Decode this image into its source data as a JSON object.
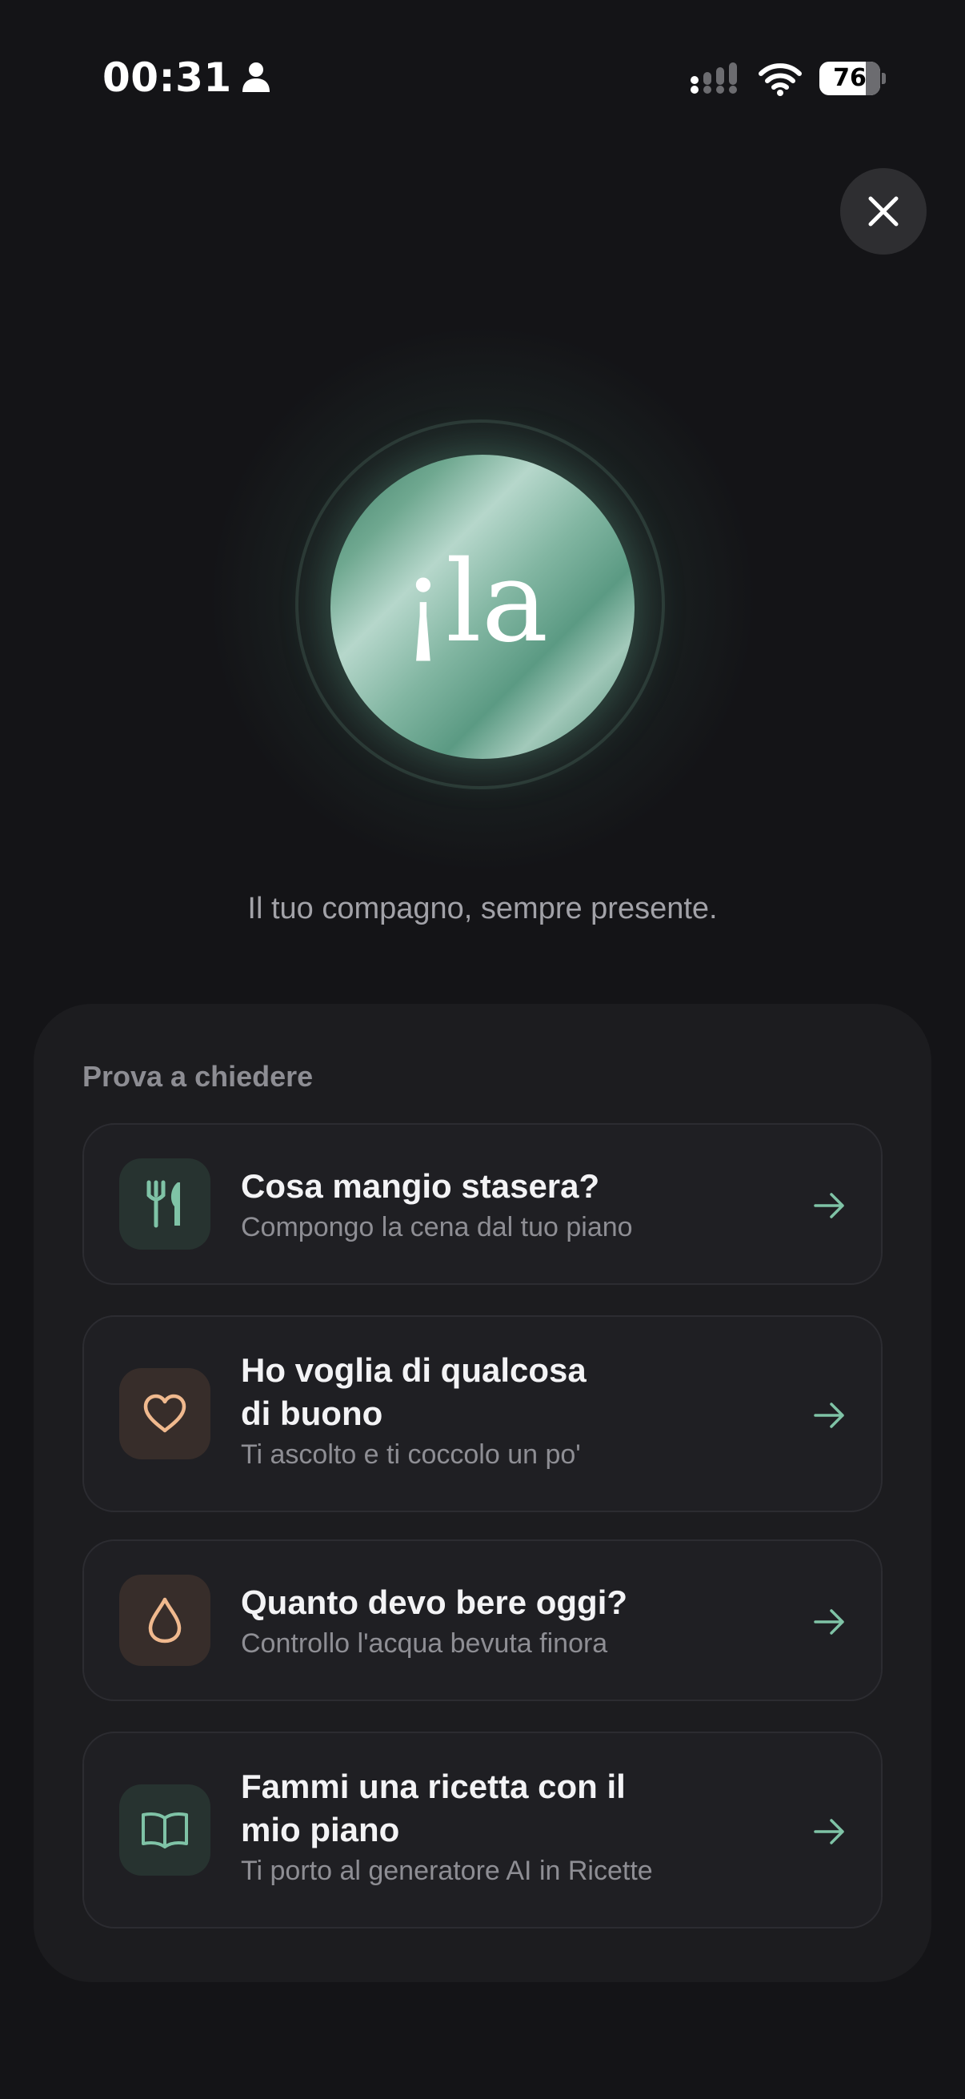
{
  "status_bar": {
    "time": "00:31",
    "battery_level": "76",
    "icons": [
      "person-icon",
      "signal-icon",
      "wifi-icon",
      "battery-icon"
    ]
  },
  "close_button": {
    "icon": "close-icon"
  },
  "logo": {
    "text": "¡la"
  },
  "tagline": "Il tuo compagno, sempre presente.",
  "suggestions": {
    "title": "Prova a chiedere",
    "items": [
      {
        "icon": "fork-knife-icon",
        "title": "Cosa mangio stasera?",
        "subtitle": "Compongo la cena dal tuo piano"
      },
      {
        "icon": "heart-icon",
        "title": "Ho voglia di qualcosa\ndi buono",
        "subtitle": "Ti ascolto e ti coccolo un po'"
      },
      {
        "icon": "water-drop-icon",
        "title": "Quanto devo bere oggi?",
        "subtitle": "Controllo l'acqua bevuta finora"
      },
      {
        "icon": "book-icon",
        "title": "Fammi una ricetta con il\nmio piano",
        "subtitle": "Ti porto al generatore AI in Ricette"
      }
    ]
  },
  "colors": {
    "background": "#141417",
    "panel": "#1c1c1f",
    "accent_green": "#7fc3a6",
    "accent_warm": "#f0b98e"
  }
}
